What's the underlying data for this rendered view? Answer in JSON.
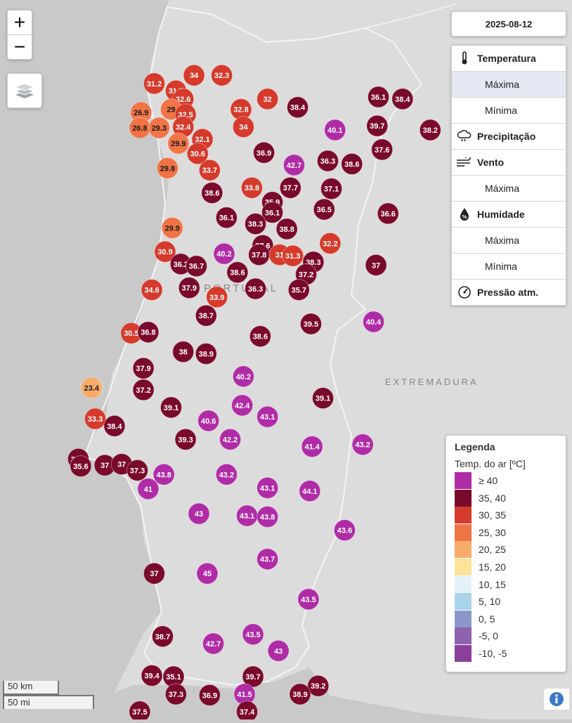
{
  "controls": {
    "zoom_in": "+",
    "zoom_out": "−",
    "layers_icon": "layers-icon"
  },
  "date": "2025-08-12",
  "menu": [
    {
      "type": "head",
      "label": "Temperatura",
      "icon": "thermometer-icon"
    },
    {
      "type": "sub",
      "label": "Máxima",
      "selected": true
    },
    {
      "type": "sub",
      "label": "Mínima"
    },
    {
      "type": "head",
      "label": "Precipitação",
      "icon": "rain-cloud-icon"
    },
    {
      "type": "head",
      "label": "Vento",
      "icon": "wind-icon"
    },
    {
      "type": "sub",
      "label": "Máxima"
    },
    {
      "type": "head",
      "label": "Humidade",
      "icon": "humidity-drop-icon"
    },
    {
      "type": "sub",
      "label": "Máxima"
    },
    {
      "type": "sub",
      "label": "Mínima"
    },
    {
      "type": "head",
      "label": "Pressão atm.",
      "icon": "gauge-icon"
    }
  ],
  "map_labels": {
    "country": "PORTUGAL",
    "region": "EXTREMADURA"
  },
  "legend": {
    "title": "Legenda",
    "subtitle": "Temp. do ar [ºC]",
    "classes": [
      {
        "label": "≥ 40",
        "color": "#b02ca6"
      },
      {
        "label": "35, 40",
        "color": "#7a0a2c"
      },
      {
        "label": "30, 35",
        "color": "#d53a2b"
      },
      {
        "label": "25, 30",
        "color": "#f07446"
      },
      {
        "label": "20, 25",
        "color": "#f8ac6a"
      },
      {
        "label": "15, 20",
        "color": "#fde29c"
      },
      {
        "label": "10, 15",
        "color": "#e2f2f8"
      },
      {
        "label": "5, 10",
        "color": "#a8d3e8"
      },
      {
        "label": "0, 5",
        "color": "#8b97c8"
      },
      {
        "label": "-5, 0",
        "color": "#8e62ae"
      },
      {
        "label": "-10, -5",
        "color": "#8a3f9a"
      }
    ]
  },
  "scale": {
    "km": "50 km",
    "mi": "50 mi"
  },
  "info_icon": "info-icon",
  "stations": [
    {
      "v": "34",
      "lon": -8.51,
      "lat": 42.13
    },
    {
      "v": "32.3",
      "lon": -8.28,
      "lat": 42.13
    },
    {
      "v": "31.2",
      "lon": -8.84,
      "lat": 42.05
    },
    {
      "v": "31.5",
      "lon": -8.66,
      "lat": 41.98
    },
    {
      "v": "32.6",
      "lon": -8.6,
      "lat": 41.9
    },
    {
      "v": "32",
      "lon": -7.9,
      "lat": 41.9
    },
    {
      "v": "36.1",
      "lon": -6.98,
      "lat": 41.92
    },
    {
      "v": "38.4",
      "lon": -6.78,
      "lat": 41.9
    },
    {
      "v": "38.4",
      "lon": -7.65,
      "lat": 41.82
    },
    {
      "v": "26.9",
      "lon": -8.95,
      "lat": 41.77
    },
    {
      "v": "29",
      "lon": -8.7,
      "lat": 41.8
    },
    {
      "v": "32.5",
      "lon": -8.58,
      "lat": 41.75
    },
    {
      "v": "32.8",
      "lon": -8.12,
      "lat": 41.8
    },
    {
      "v": "34",
      "lon": -8.1,
      "lat": 41.63
    },
    {
      "v": "26.8",
      "lon": -8.96,
      "lat": 41.62
    },
    {
      "v": "29.3",
      "lon": -8.8,
      "lat": 41.62
    },
    {
      "v": "32.4",
      "lon": -8.6,
      "lat": 41.63
    },
    {
      "v": "40.1",
      "lon": -7.34,
      "lat": 41.6
    },
    {
      "v": "39.7",
      "lon": -6.99,
      "lat": 41.64
    },
    {
      "v": "38.2",
      "lon": -6.55,
      "lat": 41.6
    },
    {
      "v": "32.1",
      "lon": -8.44,
      "lat": 41.51
    },
    {
      "v": "29.9",
      "lon": -8.64,
      "lat": 41.47
    },
    {
      "v": "36.9",
      "lon": -7.93,
      "lat": 41.38
    },
    {
      "v": "37.6",
      "lon": -6.95,
      "lat": 41.41
    },
    {
      "v": "30.6",
      "lon": -8.48,
      "lat": 41.37
    },
    {
      "v": "36.3",
      "lon": -7.4,
      "lat": 41.3
    },
    {
      "v": "38.6",
      "lon": -7.2,
      "lat": 41.27
    },
    {
      "v": "42.7",
      "lon": -7.68,
      "lat": 41.26
    },
    {
      "v": "29.8",
      "lon": -8.73,
      "lat": 41.23
    },
    {
      "v": "33.7",
      "lon": -8.38,
      "lat": 41.21
    },
    {
      "v": "33.8",
      "lon": -8.03,
      "lat": 41.04
    },
    {
      "v": "37.7",
      "lon": -7.71,
      "lat": 41.04
    },
    {
      "v": "37.1",
      "lon": -7.37,
      "lat": 41.03
    },
    {
      "v": "38.6",
      "lon": -8.36,
      "lat": 40.99
    },
    {
      "v": "35.9",
      "lon": -7.86,
      "lat": 40.9
    },
    {
      "v": "36.5",
      "lon": -7.43,
      "lat": 40.83
    },
    {
      "v": "36.6",
      "lon": -6.9,
      "lat": 40.79
    },
    {
      "v": "36.1",
      "lon": -7.86,
      "lat": 40.8
    },
    {
      "v": "36.1",
      "lon": -8.24,
      "lat": 40.75
    },
    {
      "v": "38.3",
      "lon": -8.0,
      "lat": 40.69
    },
    {
      "v": "38.8",
      "lon": -7.74,
      "lat": 40.64
    },
    {
      "v": "29.9",
      "lon": -8.69,
      "lat": 40.65
    },
    {
      "v": "32.2",
      "lon": -7.38,
      "lat": 40.5
    },
    {
      "v": "37.6",
      "lon": -7.94,
      "lat": 40.48
    },
    {
      "v": "30.9",
      "lon": -8.75,
      "lat": 40.42
    },
    {
      "v": "40.2",
      "lon": -8.26,
      "lat": 40.4
    },
    {
      "v": "37.8",
      "lon": -7.97,
      "lat": 40.39
    },
    {
      "v": "31",
      "lon": -7.8,
      "lat": 40.39
    },
    {
      "v": "31.3",
      "lon": -7.69,
      "lat": 40.38
    },
    {
      "v": "38.3",
      "lon": -7.52,
      "lat": 40.32
    },
    {
      "v": "36.2",
      "lon": -8.62,
      "lat": 40.3
    },
    {
      "v": "36.7",
      "lon": -8.49,
      "lat": 40.28
    },
    {
      "v": "37",
      "lon": -7.0,
      "lat": 40.29
    },
    {
      "v": "37.2",
      "lon": -7.58,
      "lat": 40.2
    },
    {
      "v": "38.6",
      "lon": -8.15,
      "lat": 40.22
    },
    {
      "v": "34.6",
      "lon": -8.86,
      "lat": 40.05
    },
    {
      "v": "37.9",
      "lon": -8.55,
      "lat": 40.07
    },
    {
      "v": "36.3",
      "lon": -8.0,
      "lat": 40.06
    },
    {
      "v": "35.7",
      "lon": -7.64,
      "lat": 40.05
    },
    {
      "v": "33.9",
      "lon": -8.32,
      "lat": 39.98
    },
    {
      "v": "38.7",
      "lon": -8.41,
      "lat": 39.8
    },
    {
      "v": "40.4",
      "lon": -7.02,
      "lat": 39.74
    },
    {
      "v": "39.5",
      "lon": -7.54,
      "lat": 39.72
    },
    {
      "v": "30.5",
      "lon": -9.03,
      "lat": 39.63
    },
    {
      "v": "36.8",
      "lon": -8.89,
      "lat": 39.64
    },
    {
      "v": "38.6",
      "lon": -7.96,
      "lat": 39.6
    },
    {
      "v": "38",
      "lon": -8.6,
      "lat": 39.45
    },
    {
      "v": "38.9",
      "lon": -8.41,
      "lat": 39.43
    },
    {
      "v": "37.9",
      "lon": -8.93,
      "lat": 39.29
    },
    {
      "v": "40.2",
      "lon": -8.1,
      "lat": 39.21
    },
    {
      "v": "23.4",
      "lon": -9.36,
      "lat": 39.1
    },
    {
      "v": "37.2",
      "lon": -8.93,
      "lat": 39.08
    },
    {
      "v": "39.1",
      "lon": -7.44,
      "lat": 39.0
    },
    {
      "v": "39.1",
      "lon": -8.7,
      "lat": 38.91
    },
    {
      "v": "42.4",
      "lon": -8.11,
      "lat": 38.93
    },
    {
      "v": "43.1",
      "lon": -7.9,
      "lat": 38.82
    },
    {
      "v": "33.3",
      "lon": -9.33,
      "lat": 38.8
    },
    {
      "v": "40.6",
      "lon": -8.39,
      "lat": 38.78
    },
    {
      "v": "38.4",
      "lon": -9.17,
      "lat": 38.73
    },
    {
      "v": "39.3",
      "lon": -8.58,
      "lat": 38.6
    },
    {
      "v": "42.2",
      "lon": -8.21,
      "lat": 38.6
    },
    {
      "v": "41.4",
      "lon": -7.53,
      "lat": 38.53
    },
    {
      "v": "43.2",
      "lon": -7.11,
      "lat": 38.55
    },
    {
      "v": "35.3",
      "lon": -9.47,
      "lat": 38.41
    },
    {
      "v": "35.6",
      "lon": -9.45,
      "lat": 38.34
    },
    {
      "v": "37",
      "lon": -9.25,
      "lat": 38.35
    },
    {
      "v": "37",
      "lon": -9.11,
      "lat": 38.36
    },
    {
      "v": "37.3",
      "lon": -8.98,
      "lat": 38.3
    },
    {
      "v": "43.8",
      "lon": -8.76,
      "lat": 38.26
    },
    {
      "v": "43.2",
      "lon": -8.24,
      "lat": 38.26
    },
    {
      "v": "41",
      "lon": -8.89,
      "lat": 38.12
    },
    {
      "v": "43.1",
      "lon": -7.9,
      "lat": 38.13
    },
    {
      "v": "44.1",
      "lon": -7.55,
      "lat": 38.1
    },
    {
      "v": "43",
      "lon": -8.47,
      "lat": 37.88
    },
    {
      "v": "43.1",
      "lon": -8.07,
      "lat": 37.86
    },
    {
      "v": "43.8",
      "lon": -7.9,
      "lat": 37.85
    },
    {
      "v": "43.6",
      "lon": -7.26,
      "lat": 37.72
    },
    {
      "v": "43.7",
      "lon": -7.9,
      "lat": 37.44
    },
    {
      "v": "37",
      "lon": -8.84,
      "lat": 37.3
    },
    {
      "v": "45",
      "lon": -8.4,
      "lat": 37.3
    },
    {
      "v": "43.5",
      "lon": -7.56,
      "lat": 37.05
    },
    {
      "v": "38.7",
      "lon": -8.77,
      "lat": 36.69
    },
    {
      "v": "43.5",
      "lon": -8.02,
      "lat": 36.71
    },
    {
      "v": "42.7",
      "lon": -8.35,
      "lat": 36.62
    },
    {
      "v": "43",
      "lon": -7.81,
      "lat": 36.55
    },
    {
      "v": "39.4",
      "lon": -8.86,
      "lat": 36.31
    },
    {
      "v": "35.1",
      "lon": -8.68,
      "lat": 36.3
    },
    {
      "v": "39.7",
      "lon": -8.02,
      "lat": 36.3
    },
    {
      "v": "39.2",
      "lon": -7.48,
      "lat": 36.21
    },
    {
      "v": "38.9",
      "lon": -7.63,
      "lat": 36.13
    },
    {
      "v": "37.3",
      "lon": -8.66,
      "lat": 36.13
    },
    {
      "v": "36.9",
      "lon": -8.38,
      "lat": 36.12
    },
    {
      "v": "41.5",
      "lon": -8.09,
      "lat": 36.13
    },
    {
      "v": "37.5",
      "lon": -8.96,
      "lat": 35.96
    },
    {
      "v": "37.4",
      "lon": -8.07,
      "lat": 35.96
    }
  ]
}
